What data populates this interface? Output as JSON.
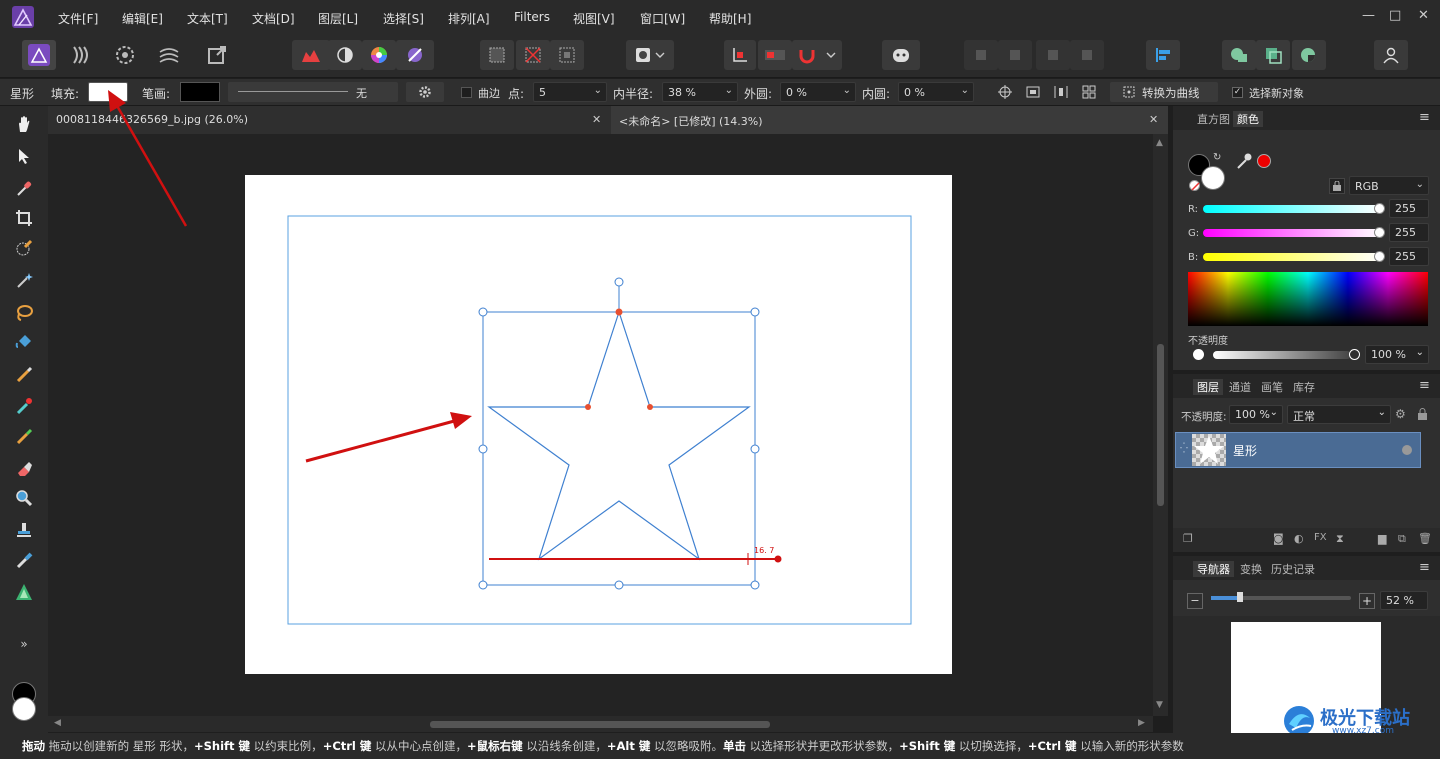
{
  "menubar": {
    "items": [
      "文件[F]",
      "编辑[E]",
      "文本[T]",
      "文档[D]",
      "图层[L]",
      "选择[S]",
      "排列[A]",
      "Filters",
      "视图[V]",
      "窗口[W]",
      "帮助[H]"
    ],
    "window_controls": [
      "—",
      "□",
      "✕"
    ]
  },
  "context_bar": {
    "tool_name": "星形",
    "fill_label": "填充:",
    "stroke_label": "笔画:",
    "stroke_style_value": "无",
    "curve_label": "曲边",
    "points_label": "点:",
    "points_value": "5",
    "inner_radius_label": "内半径:",
    "inner_radius_value": "38 %",
    "outer_round_label": "外圆:",
    "outer_round_value": "0 %",
    "inner_round_label": "内圆:",
    "inner_round_value": "0 %",
    "convert_label": "转换为曲线",
    "select_new_label": "选择新对象",
    "fill_color": "#ffffff",
    "stroke_color": "#000000"
  },
  "doc_tabs": [
    {
      "label": "0008118446326569_b.jpg (26.0%)",
      "close": "✕"
    },
    {
      "label": "<未命名> [已修改] (14.3%)",
      "close": "✕"
    }
  ],
  "canvas": {
    "measure_label": "16. 7"
  },
  "color_panel": {
    "tabs": [
      "直方图",
      "颜色"
    ],
    "mode": "RGB",
    "channels": [
      {
        "label": "R:",
        "value": "255"
      },
      {
        "label": "G:",
        "value": "255"
      },
      {
        "label": "B:",
        "value": "255"
      }
    ],
    "opacity_label": "不透明度",
    "opacity_value": "100 %"
  },
  "layers_panel": {
    "tabs": [
      "图层",
      "通道",
      "画笔",
      "库存"
    ],
    "opacity_label": "不透明度:",
    "opacity_value": "100 %",
    "blend_mode": "正常",
    "layers": [
      {
        "name": "星形"
      }
    ]
  },
  "navigator_panel": {
    "tabs": [
      "导航器",
      "变换",
      "历史记录"
    ],
    "zoom_value": "52 %",
    "minus": "−",
    "plus": "+"
  },
  "status": {
    "segments": [
      {
        "b": "拖动",
        "t": " 拖动以创建新的 星形 形状，"
      },
      {
        "b": "+Shift 键",
        "t": " 以约束比例，"
      },
      {
        "b": "+Ctrl 键",
        "t": " 以从中心点创建，"
      },
      {
        "b": "+鼠标右键",
        "t": " 以沿线条创建，"
      },
      {
        "b": "+Alt 键",
        "t": " 以忽略吸附。"
      },
      {
        "b": "单击",
        "t": " 以选择形状并更改形状参数，"
      },
      {
        "b": "+Shift 键",
        "t": " 以切换选择，"
      },
      {
        "b": "+Ctrl 键",
        "t": " 以输入新的形状参数"
      }
    ]
  },
  "watermark": {
    "text": "极光下载站",
    "url": "www.xz7.com"
  },
  "colors": {
    "accent": "#4a6b94",
    "selection_blue": "#4a8fd8",
    "arrow_red": "#d01010"
  }
}
